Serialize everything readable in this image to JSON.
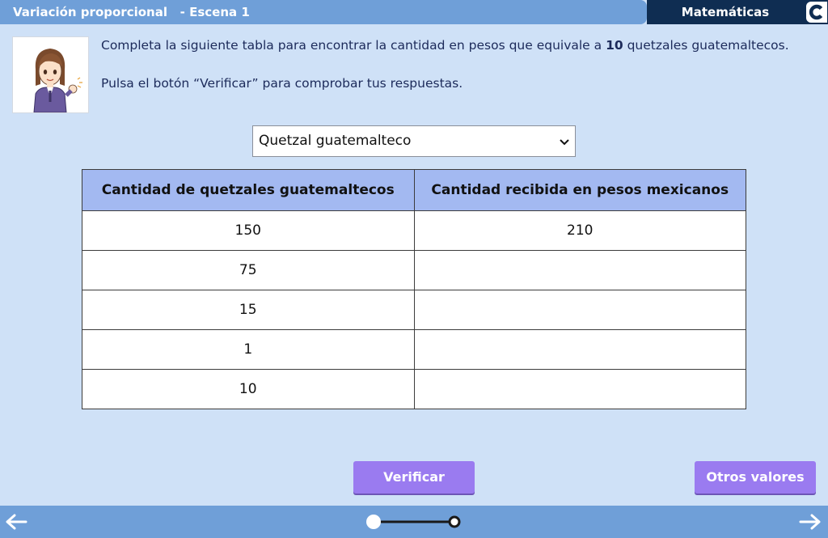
{
  "header": {
    "title": "Variación proporcional   - Escena 1",
    "subject": "Matemáticas",
    "logo_icon": "c-logo-icon"
  },
  "instructions": {
    "line1_before": "Completa la siguiente tabla para encontrar la cantidad en pesos que equivale a ",
    "line1_bold": "10",
    "line1_after": " quetzales guatemaltecos.",
    "line2": "Pulsa el botón “Verificar” para comprobar tus respuestas."
  },
  "currency_select": {
    "selected": "Quetzal guatemalteco"
  },
  "table": {
    "headers": [
      "Cantidad de quetzales guatemaltecos",
      "Cantidad recibida en pesos mexicanos"
    ],
    "rows": [
      [
        "150",
        "210"
      ],
      [
        "75",
        ""
      ],
      [
        "15",
        ""
      ],
      [
        "1",
        ""
      ],
      [
        "10",
        ""
      ]
    ]
  },
  "buttons": {
    "verify": "Verificar",
    "other_values": "Otros valores"
  },
  "colors": {
    "title_bar": "#6f9fd8",
    "subject_bar": "#0f2d52",
    "background": "#cfe1f7",
    "table_header": "#a3b9f1",
    "button": "#9a7bf0"
  },
  "navigation": {
    "prev_icon": "arrow-left-icon",
    "next_icon": "arrow-right-icon",
    "progress_step": 1,
    "progress_total": 2
  }
}
